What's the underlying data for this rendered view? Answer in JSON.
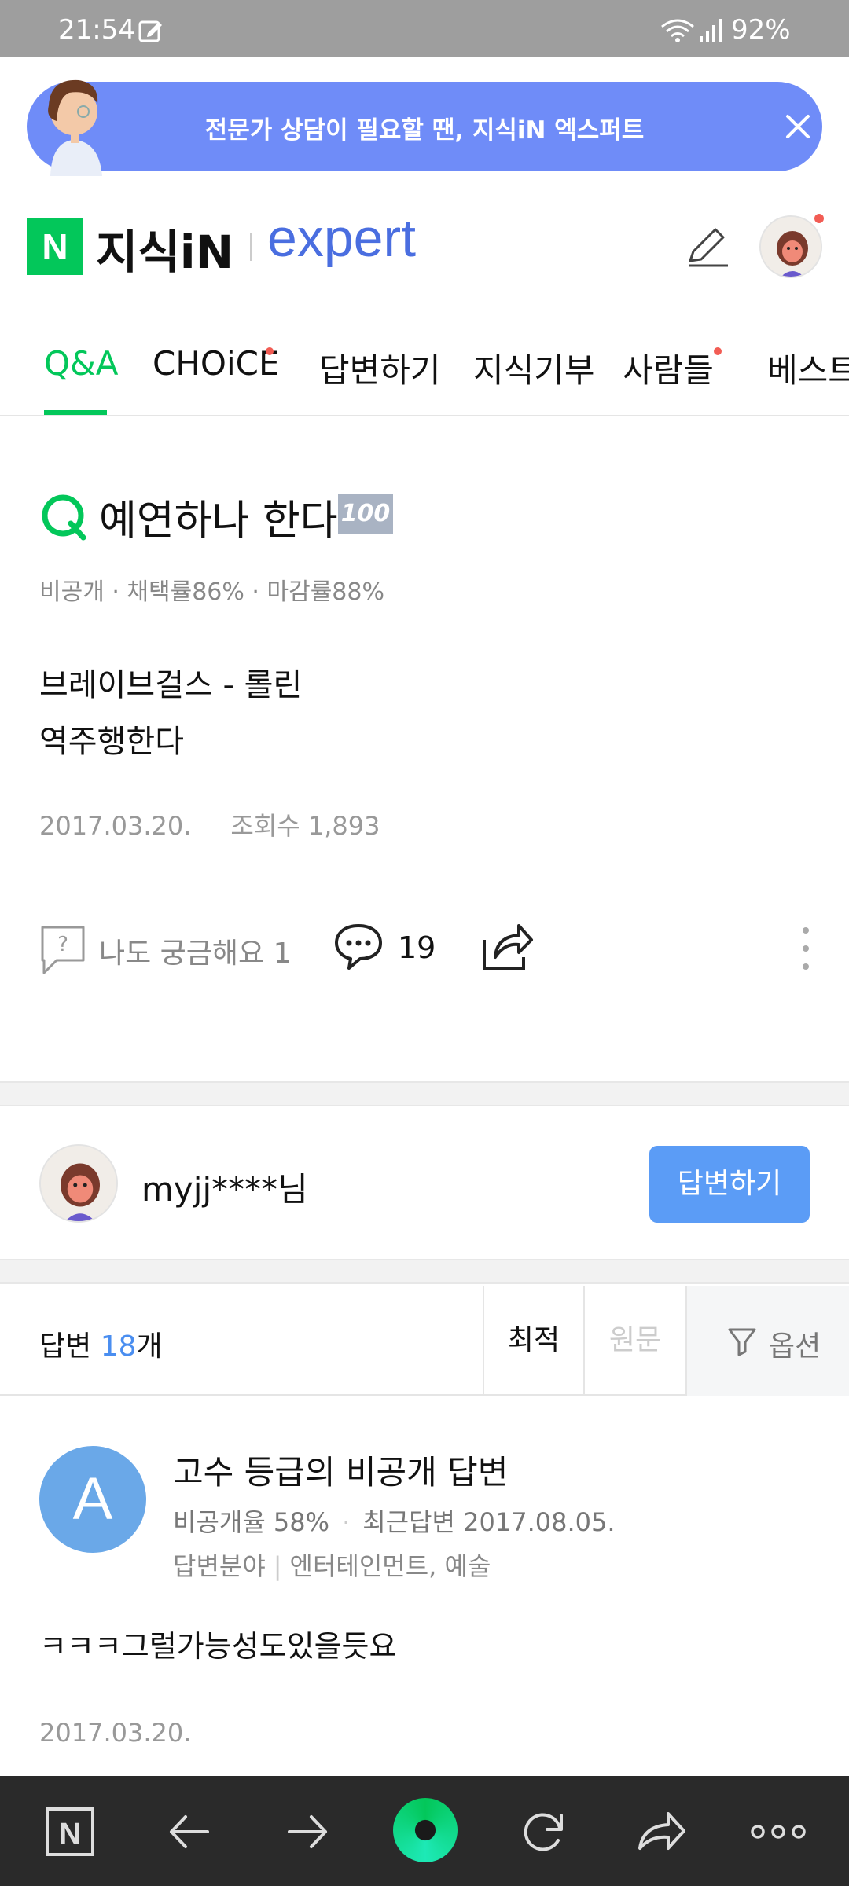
{
  "status_bar": {
    "time": "21:54",
    "battery": "92%"
  },
  "banner": {
    "text": "전문가 상담이 필요할 땐, 지식iN 엑스퍼트"
  },
  "header": {
    "logo_n": "N",
    "logo_jisik": "지식iN",
    "logo_expert": "expert"
  },
  "tabs": [
    {
      "label": "Q&A",
      "active": true
    },
    {
      "label": "CHOiCE",
      "has_dot": true
    },
    {
      "label": "답변하기"
    },
    {
      "label": "지식기부"
    },
    {
      "label": "사람들",
      "has_dot": true
    },
    {
      "label": "베스트"
    }
  ],
  "question": {
    "title": "예연하나 한다",
    "badge": "100",
    "meta": "비공개 · 채택률86% · 마감률88%",
    "body_line1": "브레이브걸스 - 롤린",
    "body_line2": "역주행한다",
    "date": "2017.03.20.",
    "views": "조회수 1,893"
  },
  "actions": {
    "curious_label": "나도 궁금해요 1",
    "comment_count": "19"
  },
  "answer_prompt": {
    "user": "myjj****님",
    "button": "답변하기"
  },
  "answers_bar": {
    "label_prefix": "답변 ",
    "count": "18",
    "label_suffix": "개",
    "sort_best": "최적",
    "sort_orig": "원문",
    "option": "옵션"
  },
  "answer": {
    "avatar_letter": "A",
    "title": "고수 등급의 비공개 답변",
    "rate": "비공개율 58%",
    "recent": "최근답변 2017.08.05.",
    "field_label": "답변분야",
    "field_value": "엔터테인먼트, 예술",
    "body": "ㅋㅋㅋ그럴가능성도있을듯요",
    "date": "2017.03.20."
  },
  "colors": {
    "accent_green": "#03c75a",
    "banner_blue": "#6f8cf8",
    "button_blue": "#5b9cf6",
    "expert_blue": "#4a6ee0"
  }
}
